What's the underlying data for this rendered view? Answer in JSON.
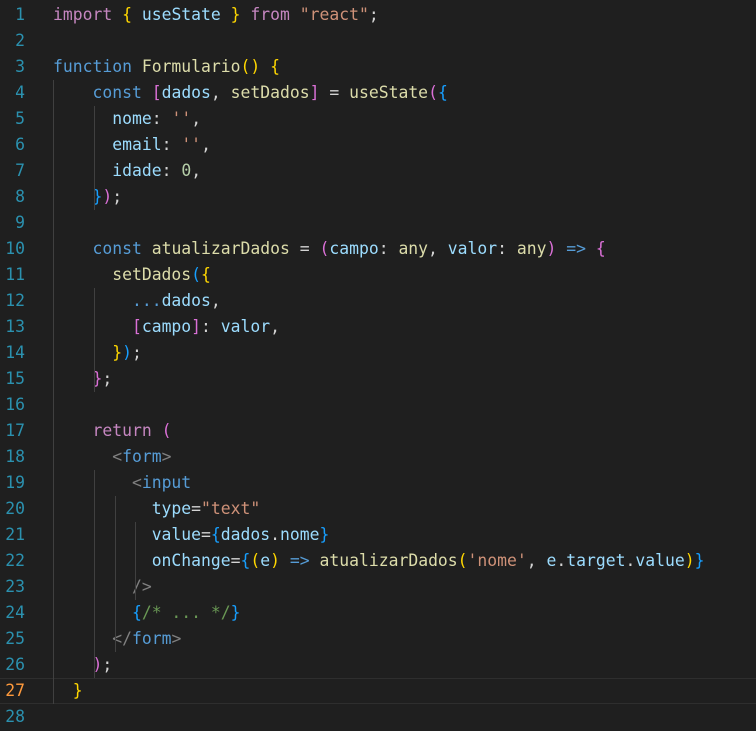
{
  "editor": {
    "current_line": 27,
    "lines": [
      {
        "n": "1",
        "tokens": [
          {
            "t": "import",
            "c": "kw"
          },
          {
            "t": " ",
            "c": "op"
          },
          {
            "t": "{",
            "c": "b1"
          },
          {
            "t": " useState ",
            "c": "var"
          },
          {
            "t": "}",
            "c": "b1"
          },
          {
            "t": " ",
            "c": "op"
          },
          {
            "t": "from",
            "c": "kw"
          },
          {
            "t": " ",
            "c": "op"
          },
          {
            "t": "\"react\"",
            "c": "str"
          },
          {
            "t": ";",
            "c": "op"
          }
        ]
      },
      {
        "n": "2",
        "tokens": []
      },
      {
        "n": "3",
        "tokens": [
          {
            "t": "function",
            "c": "st"
          },
          {
            "t": " ",
            "c": "op"
          },
          {
            "t": "Formulario",
            "c": "fn"
          },
          {
            "t": "(",
            "c": "b1"
          },
          {
            "t": ")",
            "c": "b1"
          },
          {
            "t": " ",
            "c": "op"
          },
          {
            "t": "{",
            "c": "b1"
          }
        ]
      },
      {
        "n": "4",
        "tokens": [
          {
            "t": "    ",
            "c": "op"
          },
          {
            "t": "const",
            "c": "st"
          },
          {
            "t": " ",
            "c": "op"
          },
          {
            "t": "[",
            "c": "b2"
          },
          {
            "t": "dados",
            "c": "var"
          },
          {
            "t": ", ",
            "c": "op"
          },
          {
            "t": "setDados",
            "c": "fn"
          },
          {
            "t": "]",
            "c": "b2"
          },
          {
            "t": " = ",
            "c": "op"
          },
          {
            "t": "useState",
            "c": "fn"
          },
          {
            "t": "(",
            "c": "b2"
          },
          {
            "t": "{",
            "c": "b3"
          }
        ]
      },
      {
        "n": "5",
        "tokens": [
          {
            "t": "      ",
            "c": "op"
          },
          {
            "t": "nome",
            "c": "var"
          },
          {
            "t": ": ",
            "c": "op"
          },
          {
            "t": "''",
            "c": "str"
          },
          {
            "t": ",",
            "c": "op"
          }
        ]
      },
      {
        "n": "6",
        "tokens": [
          {
            "t": "      ",
            "c": "op"
          },
          {
            "t": "email",
            "c": "var"
          },
          {
            "t": ": ",
            "c": "op"
          },
          {
            "t": "''",
            "c": "str"
          },
          {
            "t": ",",
            "c": "op"
          }
        ]
      },
      {
        "n": "7",
        "tokens": [
          {
            "t": "      ",
            "c": "op"
          },
          {
            "t": "idade",
            "c": "var"
          },
          {
            "t": ": ",
            "c": "op"
          },
          {
            "t": "0",
            "c": "num"
          },
          {
            "t": ",",
            "c": "op"
          }
        ]
      },
      {
        "n": "8",
        "tokens": [
          {
            "t": "    ",
            "c": "op"
          },
          {
            "t": "}",
            "c": "b3"
          },
          {
            "t": ")",
            "c": "b2"
          },
          {
            "t": ";",
            "c": "op"
          }
        ]
      },
      {
        "n": "9",
        "tokens": []
      },
      {
        "n": "10",
        "tokens": [
          {
            "t": "    ",
            "c": "op"
          },
          {
            "t": "const",
            "c": "st"
          },
          {
            "t": " ",
            "c": "op"
          },
          {
            "t": "atualizarDados",
            "c": "fn"
          },
          {
            "t": " = ",
            "c": "op"
          },
          {
            "t": "(",
            "c": "b2"
          },
          {
            "t": "campo",
            "c": "var"
          },
          {
            "t": ": ",
            "c": "op"
          },
          {
            "t": "any",
            "c": "fn"
          },
          {
            "t": ", ",
            "c": "op"
          },
          {
            "t": "valor",
            "c": "var"
          },
          {
            "t": ": ",
            "c": "op"
          },
          {
            "t": "any",
            "c": "fn"
          },
          {
            "t": ")",
            "c": "b2"
          },
          {
            "t": " ",
            "c": "op"
          },
          {
            "t": "=>",
            "c": "st"
          },
          {
            "t": " ",
            "c": "op"
          },
          {
            "t": "{",
            "c": "b2"
          }
        ]
      },
      {
        "n": "11",
        "tokens": [
          {
            "t": "      ",
            "c": "op"
          },
          {
            "t": "setDados",
            "c": "fn"
          },
          {
            "t": "(",
            "c": "b3"
          },
          {
            "t": "{",
            "c": "b1"
          }
        ]
      },
      {
        "n": "12",
        "tokens": [
          {
            "t": "        ",
            "c": "op"
          },
          {
            "t": "...",
            "c": "st"
          },
          {
            "t": "dados",
            "c": "var"
          },
          {
            "t": ",",
            "c": "op"
          }
        ]
      },
      {
        "n": "13",
        "tokens": [
          {
            "t": "        ",
            "c": "op"
          },
          {
            "t": "[",
            "c": "b2"
          },
          {
            "t": "campo",
            "c": "var"
          },
          {
            "t": "]",
            "c": "b2"
          },
          {
            "t": ": ",
            "c": "op"
          },
          {
            "t": "valor",
            "c": "var"
          },
          {
            "t": ",",
            "c": "op"
          }
        ]
      },
      {
        "n": "14",
        "tokens": [
          {
            "t": "      ",
            "c": "op"
          },
          {
            "t": "}",
            "c": "b1"
          },
          {
            "t": ")",
            "c": "b3"
          },
          {
            "t": ";",
            "c": "op"
          }
        ]
      },
      {
        "n": "15",
        "tokens": [
          {
            "t": "    ",
            "c": "op"
          },
          {
            "t": "}",
            "c": "b2"
          },
          {
            "t": ";",
            "c": "op"
          }
        ]
      },
      {
        "n": "16",
        "tokens": []
      },
      {
        "n": "17",
        "tokens": [
          {
            "t": "    ",
            "c": "op"
          },
          {
            "t": "return",
            "c": "kw"
          },
          {
            "t": " ",
            "c": "op"
          },
          {
            "t": "(",
            "c": "b2"
          }
        ]
      },
      {
        "n": "18",
        "tokens": [
          {
            "t": "      ",
            "c": "op"
          },
          {
            "t": "<",
            "c": "pun"
          },
          {
            "t": "form",
            "c": "tag"
          },
          {
            "t": ">",
            "c": "pun"
          }
        ]
      },
      {
        "n": "19",
        "tokens": [
          {
            "t": "        ",
            "c": "op"
          },
          {
            "t": "<",
            "c": "pun"
          },
          {
            "t": "input",
            "c": "tag"
          }
        ]
      },
      {
        "n": "20",
        "tokens": [
          {
            "t": "          ",
            "c": "op"
          },
          {
            "t": "type",
            "c": "attr"
          },
          {
            "t": "=",
            "c": "op"
          },
          {
            "t": "\"text\"",
            "c": "str"
          }
        ]
      },
      {
        "n": "21",
        "tokens": [
          {
            "t": "          ",
            "c": "op"
          },
          {
            "t": "value",
            "c": "attr"
          },
          {
            "t": "=",
            "c": "op"
          },
          {
            "t": "{",
            "c": "b3"
          },
          {
            "t": "dados",
            "c": "var"
          },
          {
            "t": ".",
            "c": "op"
          },
          {
            "t": "nome",
            "c": "var"
          },
          {
            "t": "}",
            "c": "b3"
          }
        ]
      },
      {
        "n": "22",
        "tokens": [
          {
            "t": "          ",
            "c": "op"
          },
          {
            "t": "onChange",
            "c": "attr"
          },
          {
            "t": "=",
            "c": "op"
          },
          {
            "t": "{",
            "c": "b3"
          },
          {
            "t": "(",
            "c": "b1"
          },
          {
            "t": "e",
            "c": "var"
          },
          {
            "t": ")",
            "c": "b1"
          },
          {
            "t": " ",
            "c": "op"
          },
          {
            "t": "=>",
            "c": "st"
          },
          {
            "t": " ",
            "c": "op"
          },
          {
            "t": "atualizarDados",
            "c": "fn"
          },
          {
            "t": "(",
            "c": "b1"
          },
          {
            "t": "'nome'",
            "c": "str"
          },
          {
            "t": ", ",
            "c": "op"
          },
          {
            "t": "e",
            "c": "var"
          },
          {
            "t": ".",
            "c": "op"
          },
          {
            "t": "target",
            "c": "var"
          },
          {
            "t": ".",
            "c": "op"
          },
          {
            "t": "value",
            "c": "var"
          },
          {
            "t": ")",
            "c": "b1"
          },
          {
            "t": "}",
            "c": "b3"
          }
        ]
      },
      {
        "n": "23",
        "tokens": [
          {
            "t": "        ",
            "c": "op"
          },
          {
            "t": "/>",
            "c": "pun"
          }
        ]
      },
      {
        "n": "24",
        "tokens": [
          {
            "t": "        ",
            "c": "op"
          },
          {
            "t": "{",
            "c": "b3"
          },
          {
            "t": "/* ... */",
            "c": "cm"
          },
          {
            "t": "}",
            "c": "b3"
          }
        ]
      },
      {
        "n": "25",
        "tokens": [
          {
            "t": "      ",
            "c": "op"
          },
          {
            "t": "</",
            "c": "pun"
          },
          {
            "t": "form",
            "c": "tag"
          },
          {
            "t": ">",
            "c": "pun"
          }
        ]
      },
      {
        "n": "26",
        "tokens": [
          {
            "t": "    ",
            "c": "op"
          },
          {
            "t": ")",
            "c": "b2"
          },
          {
            "t": ";",
            "c": "op"
          }
        ]
      },
      {
        "n": "27",
        "tokens": [
          {
            "t": "  ",
            "c": "op"
          },
          {
            "t": "}",
            "c": "b1"
          }
        ]
      },
      {
        "n": "28",
        "tokens": []
      }
    ]
  },
  "colors": {
    "background": "#1f1f1f",
    "line_number": "#2b91af",
    "current_line_number": "#ff9a3c",
    "indent_guide": "#404040"
  }
}
